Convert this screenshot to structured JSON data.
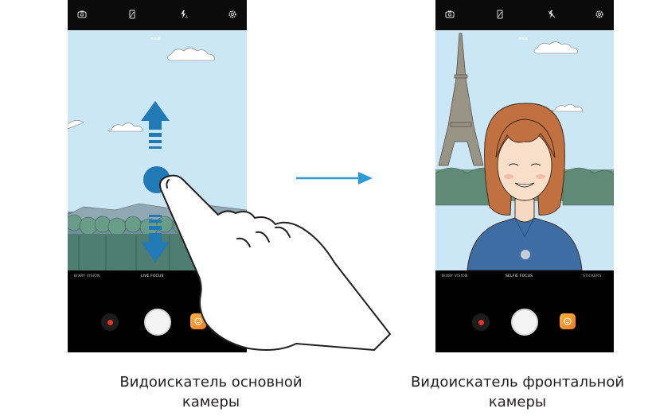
{
  "left_phone": {
    "modes": [
      "BIXBY VISION",
      "LIVE FOCUS",
      ""
    ],
    "hint": ""
  },
  "right_phone": {
    "modes": [
      "BIXBY VISION",
      "SELFIE FOCUS",
      "STICKERS"
    ],
    "hint": ""
  },
  "captions": {
    "left": "Видоискатель основной камеры",
    "right_line1": "Видоискатель фронтальной",
    "right_line2": "камеры"
  },
  "icons": {
    "switch_camera": "switch-camera-icon",
    "ratio": "ratio-icon",
    "flash_auto": "flash-auto-icon",
    "flash_off": "flash-off-icon",
    "settings": "gear-icon",
    "record": "record-icon",
    "shutter": "shutter-button",
    "stickers": "stickers-icon",
    "swipe_up": "arrow-up-icon",
    "swipe_down": "arrow-down-icon",
    "transition": "arrow-right-icon"
  },
  "colors": {
    "sky": "#cbe6f4",
    "arrow_blue": "#2179b5",
    "record_red": "#e5312a",
    "sticker_orange": "#f5922b"
  }
}
